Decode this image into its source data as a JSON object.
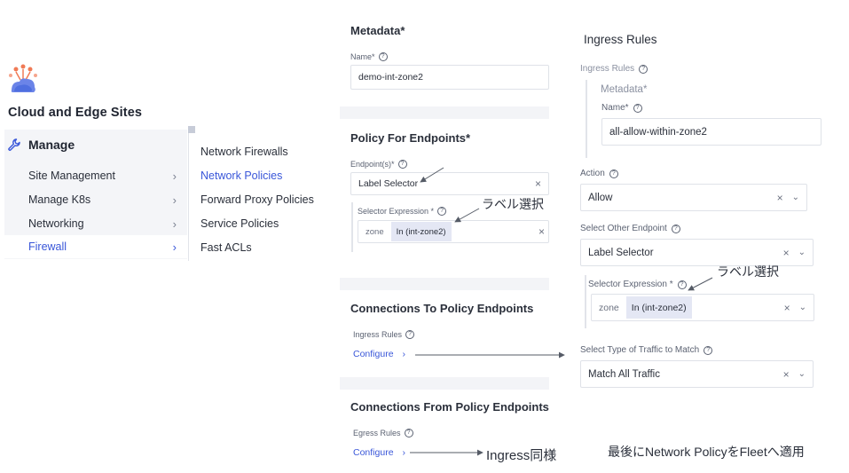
{
  "left_nav": {
    "site_title": "Cloud and Edge Sites",
    "manage_label": "Manage",
    "items": [
      {
        "label": "Site Management",
        "active": false
      },
      {
        "label": "Manage K8s",
        "active": false
      },
      {
        "label": "Networking",
        "active": false
      },
      {
        "label": "Firewall",
        "active": true
      }
    ],
    "submenu": [
      {
        "label": "Network Firewalls",
        "active": false
      },
      {
        "label": "Network Policies",
        "active": true
      },
      {
        "label": "Forward Proxy Policies",
        "active": false
      },
      {
        "label": "Service Policies",
        "active": false
      },
      {
        "label": "Fast ACLs",
        "active": false
      }
    ],
    "chevron": "›"
  },
  "middle_form": {
    "metadata_title": "Metadata",
    "required_mark": "*",
    "name_label": "Name*",
    "name_value": "demo-int-zone2",
    "policy_title": "Policy For Endpoints",
    "endpoints_label": "Endpoint(s)*",
    "endpoints_value": "Label Selector",
    "selector_label": "Selector Expression *",
    "selector_key": "zone",
    "selector_value": "In (int-zone2)",
    "annotation_label_select": "ラベル選択",
    "conn_to_title": "Connections To Policy Endpoints",
    "ingress_rules_label": "Ingress Rules",
    "configure_label": "Configure",
    "conn_from_title": "Connections From Policy Endpoints",
    "egress_rules_label": "Egress Rules",
    "configure_label_2": "Configure",
    "annotation_ingress_same": "Ingress同様",
    "clear_mark": "×",
    "help_mark": "?"
  },
  "right_form": {
    "title": "Ingress Rules",
    "ingress_rules_label": "Ingress Rules",
    "metadata_label": "Metadata",
    "required_mark": "*",
    "name_label": "Name*",
    "name_value": "all-allow-within-zone2",
    "action_label": "Action",
    "action_value": "Allow",
    "other_endpoint_label": "Select Other Endpoint",
    "other_endpoint_value": "Label Selector",
    "selector_label": "Selector Expression *",
    "selector_key": "zone",
    "selector_value": "In (int-zone2)",
    "annotation_label_select": "ラベル選択",
    "traffic_label": "Select Type of Traffic to Match",
    "traffic_value": "Match All Traffic",
    "footer_note": "最後にNetwork PolicyをFleetへ適用",
    "clear_mark": "×",
    "dropdown_mark": "⌄",
    "help_mark": "?"
  },
  "colors": {
    "accent": "#3a57d9",
    "nav_bg": "#f4f5f8",
    "tag_bg": "#e4e7f4",
    "logo_orange": "#f07a55",
    "logo_blue": "#4f6fe0"
  }
}
